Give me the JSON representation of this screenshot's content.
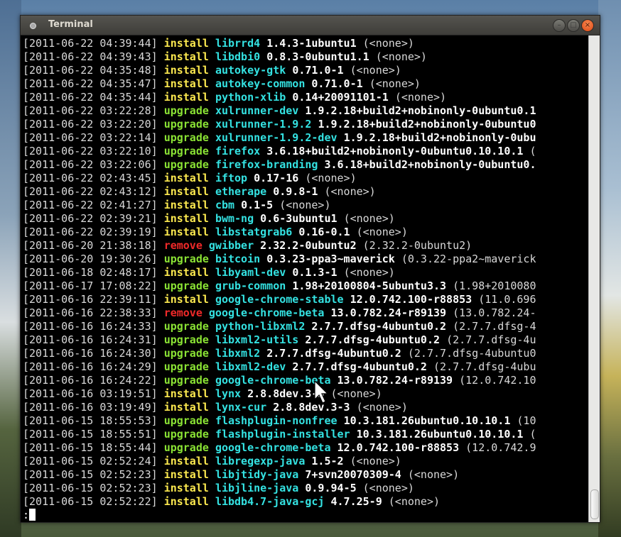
{
  "window": {
    "title": "Terminal",
    "buttons": {
      "minimize": "–",
      "maximize": "□",
      "close": "×"
    }
  },
  "log": [
    {
      "ts": "[2011-06-22 04:39:44]",
      "action": "install",
      "pkg": "librrd4",
      "ver": "1.4.3-1ubuntu1",
      "old": "(<none>)"
    },
    {
      "ts": "[2011-06-22 04:39:43]",
      "action": "install",
      "pkg": "libdbi0",
      "ver": "0.8.3-0ubuntu1.1",
      "old": "(<none>)"
    },
    {
      "ts": "[2011-06-22 04:35:48]",
      "action": "install",
      "pkg": "autokey-gtk",
      "ver": "0.71.0-1",
      "old": "(<none>)"
    },
    {
      "ts": "[2011-06-22 04:35:47]",
      "action": "install",
      "pkg": "autokey-common",
      "ver": "0.71.0-1",
      "old": "(<none>)"
    },
    {
      "ts": "[2011-06-22 04:35:44]",
      "action": "install",
      "pkg": "python-xlib",
      "ver": "0.14+20091101-1",
      "old": "(<none>)"
    },
    {
      "ts": "[2011-06-22 03:22:28]",
      "action": "upgrade",
      "pkg": "xulrunner-dev",
      "ver": "1.9.2.18+build2+nobinonly-0ubuntu0.1",
      "old": ""
    },
    {
      "ts": "[2011-06-22 03:22:20]",
      "action": "upgrade",
      "pkg": "xulrunner-1.9.2",
      "ver": "1.9.2.18+build2+nobinonly-0ubuntu0",
      "old": ""
    },
    {
      "ts": "[2011-06-22 03:22:14]",
      "action": "upgrade",
      "pkg": "xulrunner-1.9.2-dev",
      "ver": "1.9.2.18+build2+nobinonly-0ubu",
      "old": ""
    },
    {
      "ts": "[2011-06-22 03:22:10]",
      "action": "upgrade",
      "pkg": "firefox",
      "ver": "3.6.18+build2+nobinonly-0ubuntu0.10.10.1",
      "old": "("
    },
    {
      "ts": "[2011-06-22 03:22:06]",
      "action": "upgrade",
      "pkg": "firefox-branding",
      "ver": "3.6.18+build2+nobinonly-0ubuntu0.",
      "old": ""
    },
    {
      "ts": "[2011-06-22 02:43:45]",
      "action": "install",
      "pkg": "iftop",
      "ver": "0.17-16",
      "old": "(<none>)"
    },
    {
      "ts": "[2011-06-22 02:43:12]",
      "action": "install",
      "pkg": "etherape",
      "ver": "0.9.8-1",
      "old": "(<none>)"
    },
    {
      "ts": "[2011-06-22 02:41:27]",
      "action": "install",
      "pkg": "cbm",
      "ver": "0.1-5",
      "old": "(<none>)"
    },
    {
      "ts": "[2011-06-22 02:39:21]",
      "action": "install",
      "pkg": "bwm-ng",
      "ver": "0.6-3ubuntu1",
      "old": "(<none>)"
    },
    {
      "ts": "[2011-06-22 02:39:19]",
      "action": "install",
      "pkg": "libstatgrab6",
      "ver": "0.16-0.1",
      "old": "(<none>)"
    },
    {
      "ts": "[2011-06-20 21:38:18]",
      "action": "remove",
      "pkg": "gwibber",
      "ver": "2.32.2-0ubuntu2",
      "old": "(2.32.2-0ubuntu2)"
    },
    {
      "ts": "[2011-06-20 19:30:26]",
      "action": "upgrade",
      "pkg": "bitcoin",
      "ver": "0.3.23-ppa3~maverick",
      "old": "(0.3.22-ppa2~maverick"
    },
    {
      "ts": "[2011-06-18 02:48:17]",
      "action": "install",
      "pkg": "libyaml-dev",
      "ver": "0.1.3-1",
      "old": "(<none>)"
    },
    {
      "ts": "[2011-06-17 17:08:22]",
      "action": "upgrade",
      "pkg": "grub-common",
      "ver": "1.98+20100804-5ubuntu3.3",
      "old": "(1.98+2010080"
    },
    {
      "ts": "[2011-06-16 22:39:11]",
      "action": "install",
      "pkg": "google-chrome-stable",
      "ver": "12.0.742.100-r88853",
      "old": "(11.0.696"
    },
    {
      "ts": "[2011-06-16 22:38:33]",
      "action": "remove",
      "pkg": "google-chrome-beta",
      "ver": "13.0.782.24-r89139",
      "old": "(13.0.782.24-"
    },
    {
      "ts": "[2011-06-16 16:24:33]",
      "action": "upgrade",
      "pkg": "python-libxml2",
      "ver": "2.7.7.dfsg-4ubuntu0.2",
      "old": "(2.7.7.dfsg-4"
    },
    {
      "ts": "[2011-06-16 16:24:31]",
      "action": "upgrade",
      "pkg": "libxml2-utils",
      "ver": "2.7.7.dfsg-4ubuntu0.2",
      "old": "(2.7.7.dfsg-4u"
    },
    {
      "ts": "[2011-06-16 16:24:30]",
      "action": "upgrade",
      "pkg": "libxml2",
      "ver": "2.7.7.dfsg-4ubuntu0.2",
      "old": "(2.7.7.dfsg-4ubuntu0"
    },
    {
      "ts": "[2011-06-16 16:24:29]",
      "action": "upgrade",
      "pkg": "libxml2-dev",
      "ver": "2.7.7.dfsg-4ubuntu0.2",
      "old": "(2.7.7.dfsg-4ubu"
    },
    {
      "ts": "[2011-06-16 16:24:22]",
      "action": "upgrade",
      "pkg": "google-chrome-beta",
      "ver": "13.0.782.24-r89139",
      "old": "(12.0.742.10"
    },
    {
      "ts": "[2011-06-16 03:19:51]",
      "action": "install",
      "pkg": "lynx",
      "ver": "2.8.8dev.3-3",
      "old": "(<none>)"
    },
    {
      "ts": "[2011-06-16 03:19:49]",
      "action": "install",
      "pkg": "lynx-cur",
      "ver": "2.8.8dev.3-3",
      "old": "(<none>)"
    },
    {
      "ts": "[2011-06-15 18:55:53]",
      "action": "upgrade",
      "pkg": "flashplugin-nonfree",
      "ver": "10.3.181.26ubuntu0.10.10.1",
      "old": "(10"
    },
    {
      "ts": "[2011-06-15 18:55:51]",
      "action": "upgrade",
      "pkg": "flashplugin-installer",
      "ver": "10.3.181.26ubuntu0.10.10.1",
      "old": "("
    },
    {
      "ts": "[2011-06-15 18:55:44]",
      "action": "upgrade",
      "pkg": "google-chrome-beta",
      "ver": "12.0.742.100-r88853",
      "old": "(12.0.742.9"
    },
    {
      "ts": "[2011-06-15 02:52:24]",
      "action": "install",
      "pkg": "libregexp-java",
      "ver": "1.5-2",
      "old": "(<none>)"
    },
    {
      "ts": "[2011-06-15 02:52:23]",
      "action": "install",
      "pkg": "libjtidy-java",
      "ver": "7+svn20070309-4",
      "old": "(<none>)"
    },
    {
      "ts": "[2011-06-15 02:52:23]",
      "action": "install",
      "pkg": "libjline-java",
      "ver": "0.9.94-5",
      "old": "(<none>)"
    },
    {
      "ts": "[2011-06-15 02:52:22]",
      "action": "install",
      "pkg": "libdb4.7-java-gcj",
      "ver": "4.7.25-9",
      "old": "(<none>)"
    }
  ],
  "prompt": ":"
}
